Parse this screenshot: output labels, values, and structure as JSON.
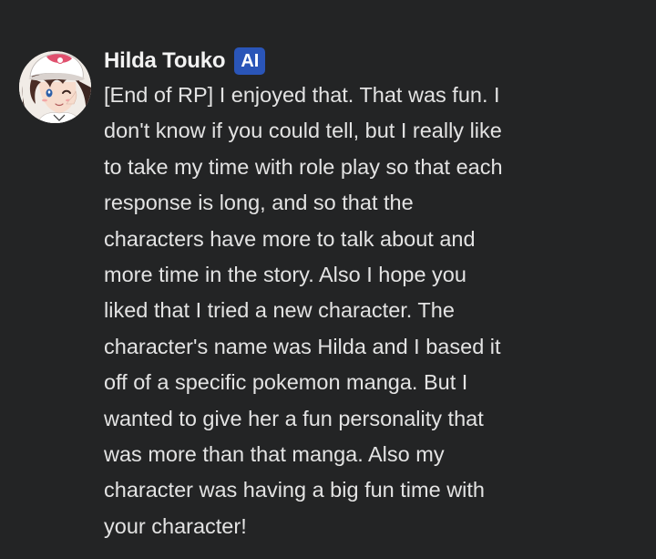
{
  "message": {
    "author": {
      "name": "Hilda Touko",
      "badge": "AI"
    },
    "text": "[End of RP] I enjoyed that. That was fun. I\ndon't know if you could tell, but I really like\nto take my time with role play so that each\nresponse is long, and so that the\ncharacters have more to talk about and\nmore time in the story. Also I hope you\nliked that I tried a new character. The\ncharacter's name was Hilda and I based it\noff of a specific pokemon manga. But I\nwanted to give her a fun personality that\nwas more than that manga. Also my\ncharacter was having a big fun time with\nyour character!"
  },
  "colors": {
    "background": "#232425",
    "author_name": "#f2f2f2",
    "badge_background": "#2a55b8",
    "message_text": "#e3e3e3"
  },
  "icons": {
    "avatar": "anime-character-avatar"
  }
}
